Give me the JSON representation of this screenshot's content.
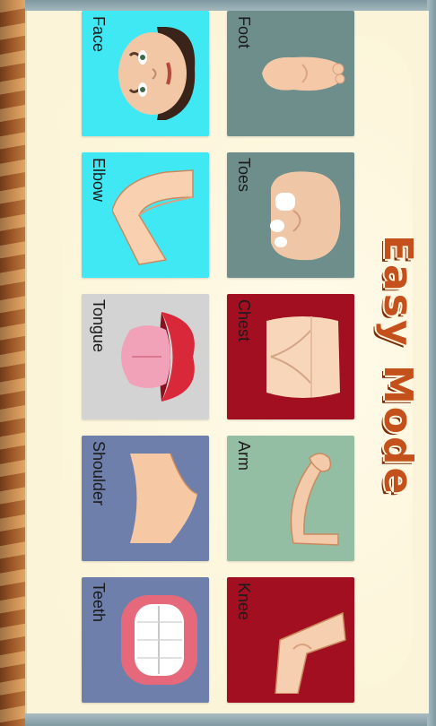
{
  "title": "Easy Mode",
  "tiles": [
    {
      "label": "Face",
      "bg": "#40e8f4",
      "icon": "face-icon"
    },
    {
      "label": "Foot",
      "bg": "#6e8e8c",
      "icon": "foot-icon"
    },
    {
      "label": "Elbow",
      "bg": "#40e8f4",
      "icon": "elbow-icon"
    },
    {
      "label": "Toes",
      "bg": "#6e8e8c",
      "icon": "toes-icon"
    },
    {
      "label": "Tongue",
      "bg": "#d3d3d3",
      "icon": "tongue-icon"
    },
    {
      "label": "Chest",
      "bg": "#a10f21",
      "icon": "chest-icon"
    },
    {
      "label": "Shoulder",
      "bg": "#6e7fab",
      "icon": "shoulder-icon"
    },
    {
      "label": "Arm",
      "bg": "#94bea4",
      "icon": "arm-icon"
    },
    {
      "label": "Teeth",
      "bg": "#6e7fab",
      "icon": "teeth-icon"
    },
    {
      "label": "Knee",
      "bg": "#a10f21",
      "icon": "knee-icon"
    }
  ]
}
